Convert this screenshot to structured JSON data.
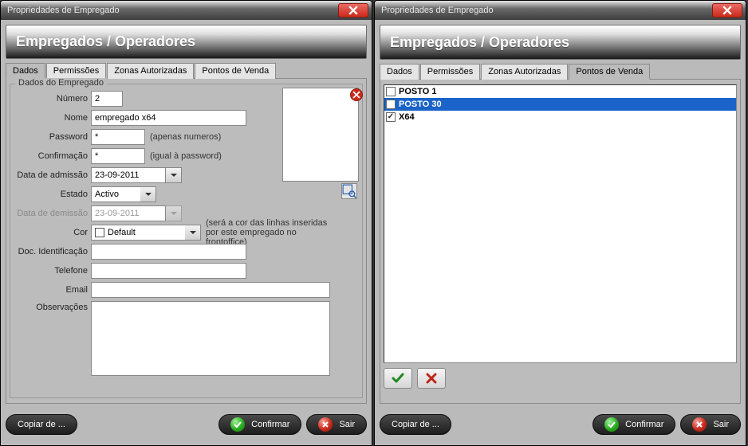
{
  "window_title": "Propriedades de Empregado",
  "banner": "Empregados / Operadores",
  "tabs": [
    "Dados",
    "Permissões",
    "Zonas Autorizadas",
    "Pontos de Venda"
  ],
  "left": {
    "active_tab": 0,
    "group_title": "Dados do Empregado",
    "labels": {
      "numero": "Número",
      "nome": "Nome",
      "password": "Password",
      "confirm": "Confirmação",
      "admissao": "Data de admissão",
      "estado": "Estado",
      "demissao": "Data de demissão",
      "cor": "Cor",
      "doc": "Doc. Identificação",
      "telefone": "Telefone",
      "email": "Email",
      "obs": "Observações"
    },
    "values": {
      "numero": "2",
      "nome": "empregado x64",
      "password": "*",
      "confirm": "*",
      "admissao": "23-09-2011",
      "estado": "Activo",
      "demissao": "23-09-2011",
      "cor": "Default",
      "doc": "",
      "telefone": "",
      "email": "",
      "obs": ""
    },
    "hints": {
      "password": "(apenas numeros)",
      "confirm": "(igual à password)",
      "cor": "(será a cor das linhas inseridas por este empregado no frontoffice)"
    }
  },
  "right": {
    "active_tab": 3,
    "items": [
      {
        "label": "POSTO 1",
        "checked": false,
        "selected": false
      },
      {
        "label": "POSTO 30",
        "checked": false,
        "selected": true
      },
      {
        "label": "X64",
        "checked": true,
        "selected": false
      }
    ]
  },
  "buttons": {
    "copiar": "Copiar de ...",
    "confirmar": "Confirmar",
    "sair": "Sair"
  }
}
